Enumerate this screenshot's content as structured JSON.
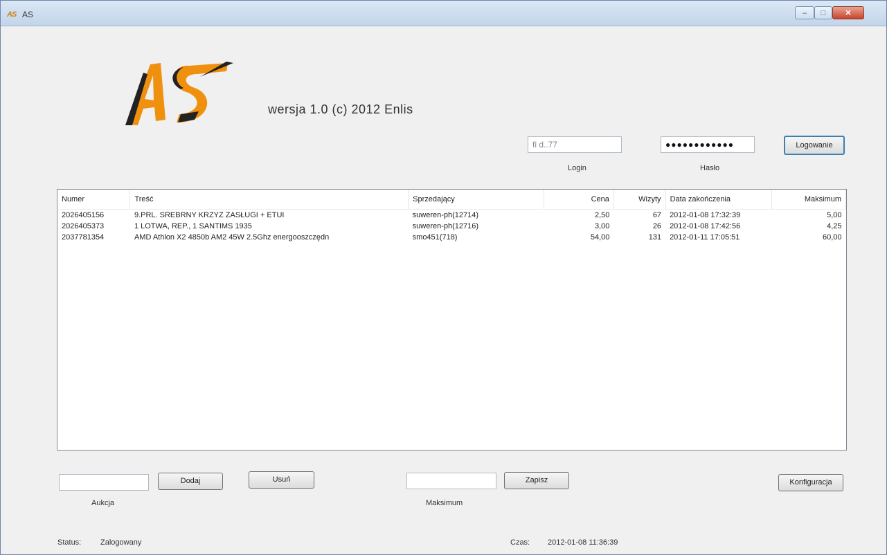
{
  "window": {
    "title": "AS",
    "icon_text": "AS"
  },
  "header": {
    "version_text": "wersja 1.0     (c) 2012 Enlis",
    "logo_text": "AS"
  },
  "login": {
    "login_value": "fi d..77",
    "login_label": "Login",
    "password_value": "●●●●●●●●●●●●",
    "password_label": "Hasło",
    "login_button": "Logowanie"
  },
  "table": {
    "columns": [
      "Numer",
      "Treść",
      "Sprzedający",
      "Cena",
      "Wizyty",
      "Data zakończenia",
      "Maksimum"
    ],
    "rows": [
      [
        "2026405156",
        "9.PRL. SREBRNY KRZYZ ZASŁUGI + ETUI",
        "suweren-ph(12714)",
        "2,50",
        "67",
        "2012-01-08 17:32:39",
        "5,00"
      ],
      [
        "2026405373",
        "1 LOTWA, REP., 1 SANTIMS 1935",
        "suweren-ph(12716)",
        "3,00",
        "26",
        "2012-01-08 17:42:56",
        "4,25"
      ],
      [
        "2037781354",
        "AMD Athlon X2 4850b AM2 45W 2.5Ghz energooszczędn",
        "smo451(718)",
        "54,00",
        "131",
        "2012-01-11 17:05:51",
        "60,00"
      ]
    ]
  },
  "controls": {
    "auction_value": "",
    "auction_label": "Aukcja",
    "add_button": "Dodaj",
    "delete_button": "Usuń",
    "max_value": "",
    "max_label": "Maksimum",
    "save_button": "Zapisz",
    "config_button": "Konfiguracja"
  },
  "status": {
    "label": "Status:",
    "value": "Zalogowany",
    "time_label": "Czas:",
    "time_value": "2012-01-08 11:36:39"
  }
}
